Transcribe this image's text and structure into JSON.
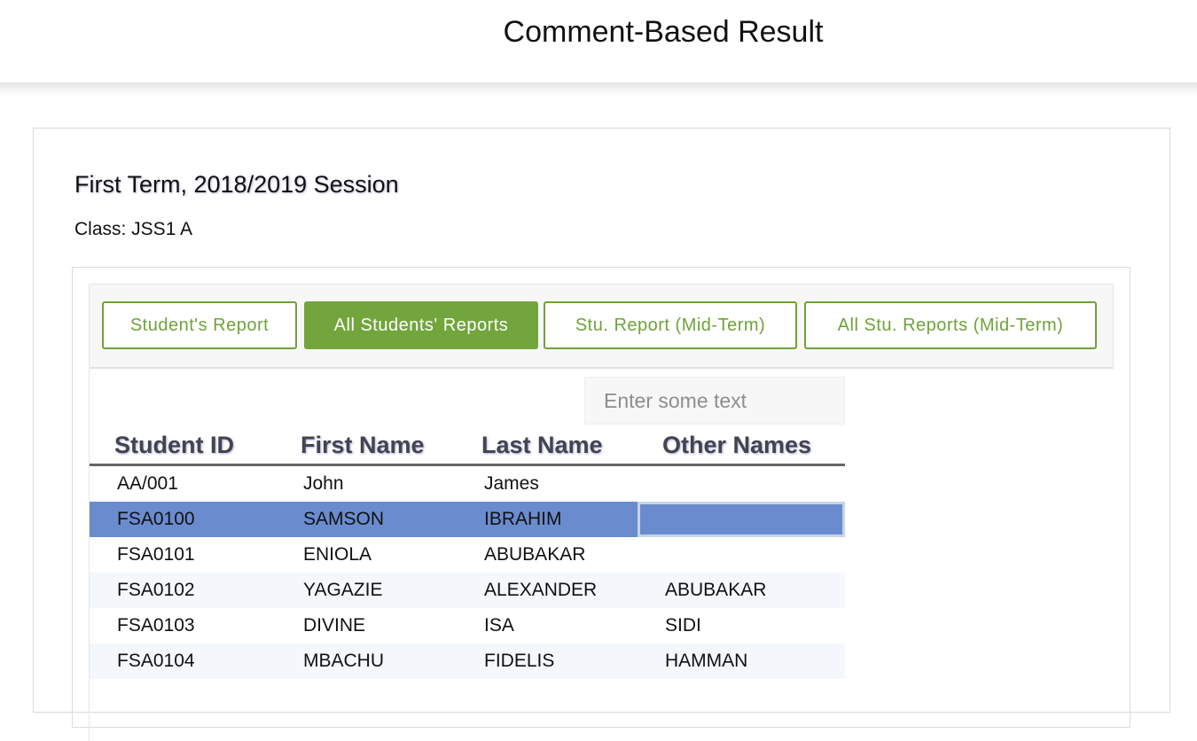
{
  "header": {
    "title": "Comment-Based Result"
  },
  "term": {
    "title": "First Term, 2018/2019 Session",
    "class": "Class: JSS1 A"
  },
  "tabs": [
    {
      "label": "Student's Report",
      "active": false
    },
    {
      "label": "All Students' Reports",
      "active": true
    },
    {
      "label": "Stu. Report (Mid-Term)",
      "active": false
    },
    {
      "label": "All Stu. Reports (Mid-Term)",
      "active": false
    }
  ],
  "search": {
    "placeholder": "Enter some text",
    "value": ""
  },
  "table": {
    "columns": [
      "Student ID",
      "First Name",
      "Last Name",
      "Other Names"
    ],
    "rows": [
      [
        "AA/001",
        "John",
        "James",
        ""
      ],
      [
        "FSA0100",
        "SAMSON",
        "IBRAHIM",
        ""
      ],
      [
        "FSA0101",
        "ENIOLA",
        "ABUBAKAR",
        ""
      ],
      [
        "FSA0102",
        "YAGAZIE",
        "ALEXANDER",
        "ABUBAKAR"
      ],
      [
        "FSA0103",
        "DIVINE",
        "ISA",
        "SIDI"
      ],
      [
        "FSA0104",
        "MBACHU",
        "FIDELIS",
        "HAMMAN"
      ]
    ],
    "selected_row": 1
  },
  "colors": {
    "accent": "#72a53c",
    "selection": "#6a8ccf"
  }
}
